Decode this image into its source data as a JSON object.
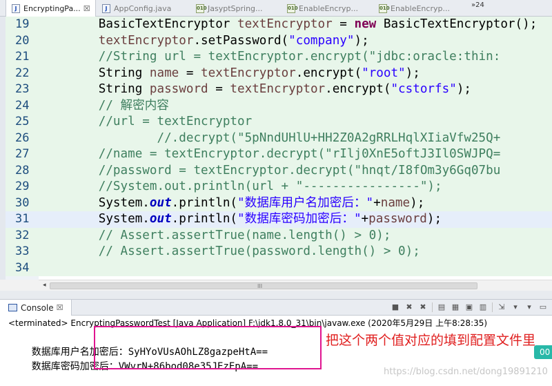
{
  "tabs": [
    {
      "label": "EncryptingPa...",
      "close": "☒",
      "icon": "J",
      "active": true
    },
    {
      "label": "AppConfig.java",
      "icon": "J"
    },
    {
      "label": "JasyptSpring...",
      "icon": "010"
    },
    {
      "label": "EnableEncryp...",
      "icon": "010"
    },
    {
      "label": "EnableEncryp...",
      "icon": "010"
    }
  ],
  "tab_overflow": "»24",
  "editor": {
    "lines": [
      {
        "num": "19",
        "code": "        BasicTextEncryptor textEncryptor = new BasicTextEncryptor();"
      },
      {
        "num": "20",
        "code": "        textEncryptor.setPassword(\"company\");"
      },
      {
        "num": "21",
        "code": "        //String url = textEncryptor.encrypt(\"jdbc:oracle:thin:"
      },
      {
        "num": "22",
        "code": "        String name = textEncryptor.encrypt(\"root\");"
      },
      {
        "num": "23",
        "code": "        String password = textEncryptor.encrypt(\"cstorfs\");"
      },
      {
        "num": "24",
        "code": "        // 解密内容"
      },
      {
        "num": "25",
        "code": "        //url = textEncryptor"
      },
      {
        "num": "26",
        "code": "                //.decrypt(\"5pNndUHlU+HH2Z0A2gRRLHqlXIiaVfw25Q+"
      },
      {
        "num": "27",
        "code": "        //name = textEncryptor.decrypt(\"rIlj0XnE5oftJ3Il0SWJPQ="
      },
      {
        "num": "28",
        "code": "        //password = textEncryptor.decrypt(\"hnqt/I8fOm3y6Gq07bu"
      },
      {
        "num": "29",
        "code": "        //System.out.println(url + \"----------------\");"
      },
      {
        "num": "30",
        "code": "        System.out.println(\"数据库用户名加密后：\"+name);"
      },
      {
        "num": "31",
        "code": "        System.out.println(\"数据库密码加密后：\"+password);"
      },
      {
        "num": "32",
        "code": "        // Assert.assertTrue(name.length() > 0);"
      },
      {
        "num": "33",
        "code": "        // Assert.assertTrue(password.length() > 0);"
      },
      {
        "num": "34",
        "code": ""
      }
    ],
    "current_line": "31",
    "scroll_grip": "III"
  },
  "console": {
    "tab_label": "Console",
    "tab_close": "☒",
    "terminated": "<terminated> EncryptingPasswordTest [Java Application] F:\\jdk1.8.0_31\\bin\\javaw.exe (2020年5月29日 上午8:28:35)",
    "output": [
      {
        "label": "数据库用户名加密后：",
        "value": "SyHYoVUsAOhLZ8gazpeHtA=="
      },
      {
        "label": "数据库密码加密后：",
        "value": "VWvrN+86bod08e35JEzEpA=="
      }
    ]
  },
  "annotation": "把这个两个值对应的填到配置文件里",
  "side_button": "00",
  "watermark": "https://blog.csdn.net/dong19891210",
  "colors": {
    "comment": "#3f7f5f",
    "keyword": "#7f0055",
    "string": "#2a00ff",
    "field": "#0000c0",
    "highlight_box": "#e0148f",
    "annotation": "#e02020"
  }
}
